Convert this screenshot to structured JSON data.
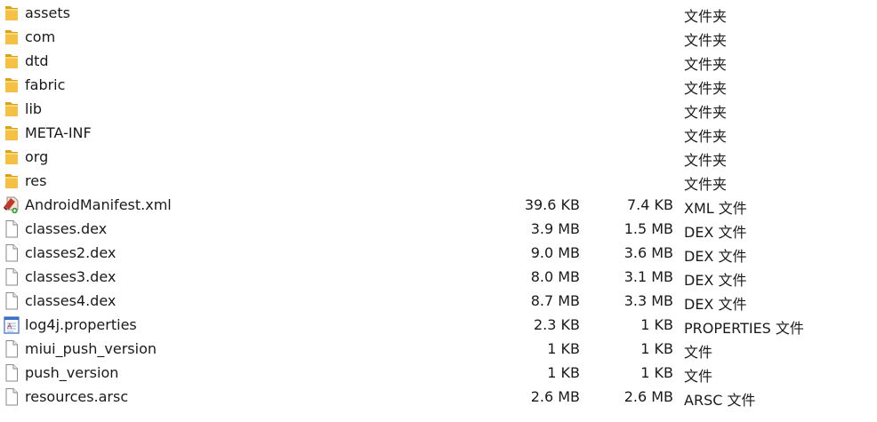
{
  "files": [
    {
      "name": "assets",
      "size": "",
      "packed": "",
      "type": "文件夹",
      "icon": "folder-icon"
    },
    {
      "name": "com",
      "size": "",
      "packed": "",
      "type": "文件夹",
      "icon": "folder-icon"
    },
    {
      "name": "dtd",
      "size": "",
      "packed": "",
      "type": "文件夹",
      "icon": "folder-icon"
    },
    {
      "name": "fabric",
      "size": "",
      "packed": "",
      "type": "文件夹",
      "icon": "folder-icon"
    },
    {
      "name": "lib",
      "size": "",
      "packed": "",
      "type": "文件夹",
      "icon": "folder-icon"
    },
    {
      "name": "META-INF",
      "size": "",
      "packed": "",
      "type": "文件夹",
      "icon": "folder-icon"
    },
    {
      "name": "org",
      "size": "",
      "packed": "",
      "type": "文件夹",
      "icon": "folder-icon"
    },
    {
      "name": "res",
      "size": "",
      "packed": "",
      "type": "文件夹",
      "icon": "folder-icon"
    },
    {
      "name": "AndroidManifest.xml",
      "size": "39.6 KB",
      "packed": "7.4 KB",
      "type": "XML 文件",
      "icon": "xml-file-icon"
    },
    {
      "name": "classes.dex",
      "size": "3.9 MB",
      "packed": "1.5 MB",
      "type": "DEX 文件",
      "icon": "file-icon"
    },
    {
      "name": "classes2.dex",
      "size": "9.0 MB",
      "packed": "3.6 MB",
      "type": "DEX 文件",
      "icon": "file-icon"
    },
    {
      "name": "classes3.dex",
      "size": "8.0 MB",
      "packed": "3.1 MB",
      "type": "DEX 文件",
      "icon": "file-icon"
    },
    {
      "name": "classes4.dex",
      "size": "8.7 MB",
      "packed": "3.3 MB",
      "type": "DEX 文件",
      "icon": "file-icon"
    },
    {
      "name": "log4j.properties",
      "size": "2.3 KB",
      "packed": "1 KB",
      "type": "PROPERTIES 文件",
      "icon": "properties-file-icon"
    },
    {
      "name": "miui_push_version",
      "size": "1 KB",
      "packed": "1 KB",
      "type": "文件",
      "icon": "file-icon"
    },
    {
      "name": "push_version",
      "size": "1 KB",
      "packed": "1 KB",
      "type": "文件",
      "icon": "file-icon"
    },
    {
      "name": "resources.arsc",
      "size": "2.6 MB",
      "packed": "2.6 MB",
      "type": "ARSC 文件",
      "icon": "file-icon"
    }
  ],
  "colors": {
    "folder": "#f5c144",
    "folder_dark": "#d9a21a",
    "file_border": "#8a8a8a",
    "xml_accent": "#c0392b",
    "xml_arrow": "#2e9e2e",
    "properties_accent": "#3a6fc4"
  }
}
